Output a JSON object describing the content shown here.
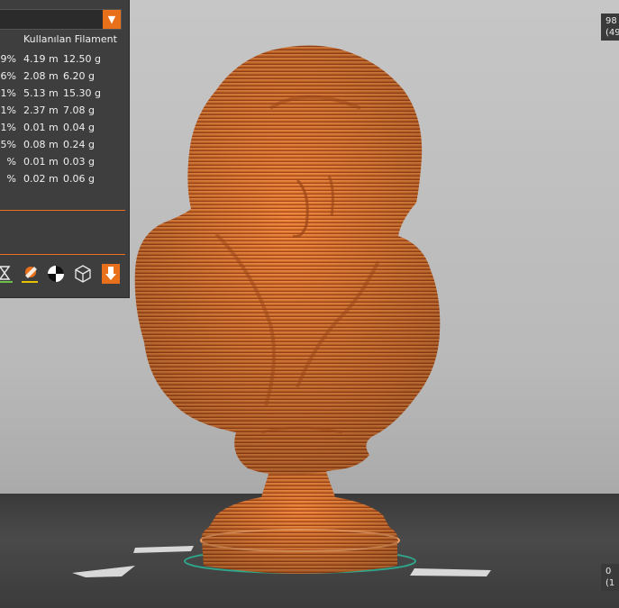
{
  "legend": {
    "column_header": "Kullanılan Filament",
    "rows": [
      {
        "pct": ",9%",
        "length": "4.19 m",
        "weight": "12.50 g"
      },
      {
        "pct": ",6%",
        "length": "2.08 m",
        "weight": "6.20 g"
      },
      {
        "pct": ",1%",
        "length": "5.13 m",
        "weight": "15.30 g"
      },
      {
        "pct": ",1%",
        "length": "2.37 m",
        "weight": "7.08 g"
      },
      {
        "pct": "1%",
        "length": "0.01 m",
        "weight": "0.04 g"
      },
      {
        "pct": "5%",
        "length": "0.08 m",
        "weight": "0.24 g"
      },
      {
        "pct": "%",
        "length": "0.01 m",
        "weight": "0.03 g"
      },
      {
        "pct": "%",
        "length": "0.02 m",
        "weight": "0.06 g"
      }
    ],
    "dropdown_arrow": "▼",
    "accent_color": "#e8701a"
  },
  "toolbar_icons": [
    "hourglass-icon",
    "color-edit-icon",
    "center-of-gravity-icon",
    "wireframe-cube-icon",
    "export-download-icon"
  ],
  "coords": {
    "top_line1": "98",
    "top_line2": "(49",
    "bottom_line1": "0",
    "bottom_line2": "(1"
  },
  "model": {
    "color": "#e07125",
    "ring_color": "#2fa58a"
  }
}
